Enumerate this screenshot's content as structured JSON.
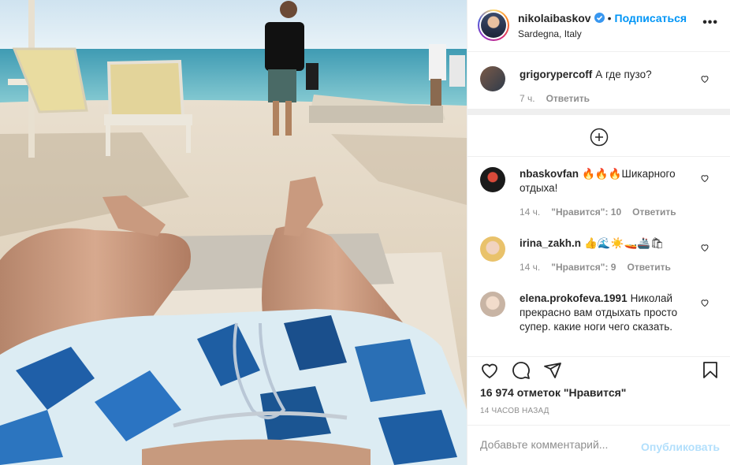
{
  "post": {
    "owner": "nikolaibaskov",
    "follow_label": "Подписаться",
    "location": "Sardegna, Italy",
    "more_label": "•••"
  },
  "comments": [
    {
      "user": "grigorypercoff",
      "text": "А где пузо?",
      "time": "7 ч.",
      "likes": "",
      "reply": "Ответить"
    },
    {
      "user": "nbaskovfan",
      "text": "🔥🔥🔥Шикарного отдыха!",
      "time": "14 ч.",
      "likes": "\"Нравится\": 10",
      "reply": "Ответить"
    },
    {
      "user": "irina_zakh.n",
      "text": "👍🌊☀️🚤🚢🛍",
      "time": "14 ч.",
      "likes": "\"Нравится\": 9",
      "reply": "Ответить"
    },
    {
      "user": "elena.prokofeva.1991",
      "text": "Николай прекрасно вам отдыхать просто супер. какие ноги чего сказать.",
      "time": "",
      "likes": "",
      "reply": ""
    }
  ],
  "actions": {
    "likes_text": "16 974 отметок \"Нравится\"",
    "time_ago": "14 ЧАСОВ НАЗАД",
    "comment_placeholder": "Добавьте комментарий...",
    "publish_label": "Опубликовать"
  },
  "colors": {
    "link_blue": "#0095f6",
    "publish_disabled": "#b2dffc",
    "text": "#262626",
    "muted": "#8e8e8e",
    "border": "#efefef"
  },
  "icons": [
    "verified-badge-icon",
    "more-options-icon",
    "heart-icon",
    "plus-circle-icon",
    "comment-icon",
    "share-icon",
    "bookmark-icon"
  ]
}
